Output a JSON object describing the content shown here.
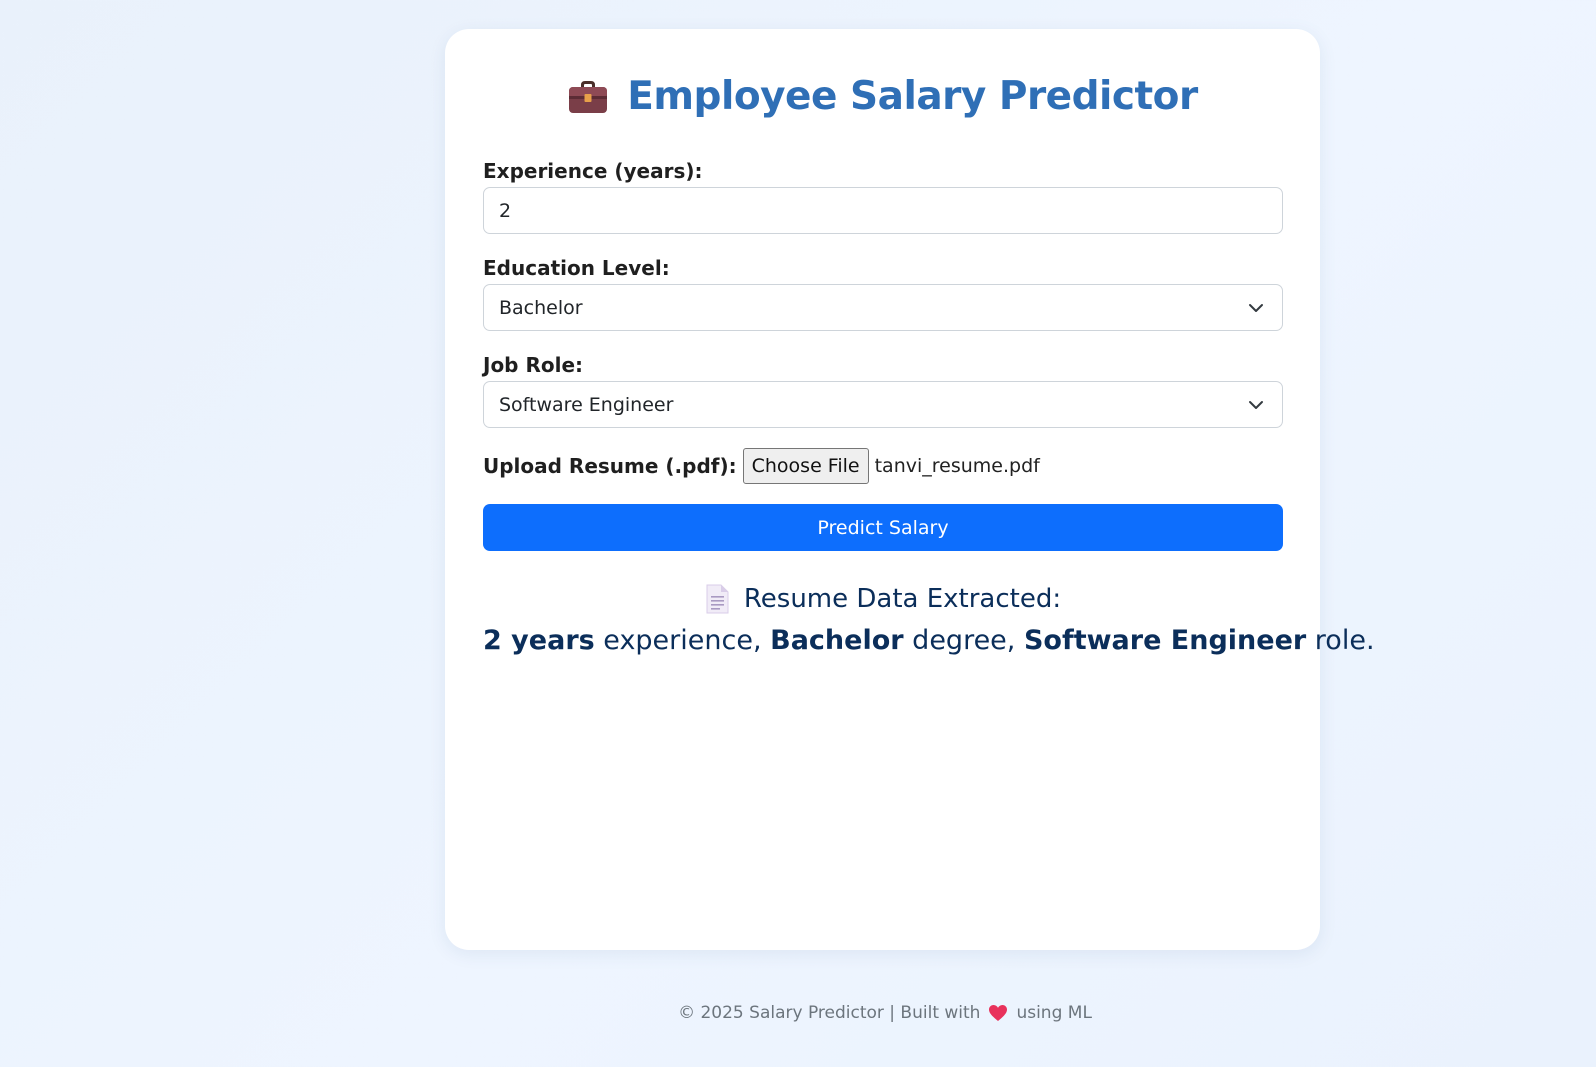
{
  "header": {
    "title": "Employee Salary Predictor",
    "icon": "briefcase-icon"
  },
  "form": {
    "experience": {
      "label": "Experience (years):",
      "value": "2"
    },
    "education": {
      "label": "Education Level:",
      "selected": "Bachelor"
    },
    "job_role": {
      "label": "Job Role:",
      "selected": "Software Engineer"
    },
    "resume": {
      "label": "Upload Resume (.pdf):",
      "button_label": "Choose File",
      "file_name": "tanvi_resume.pdf"
    },
    "submit_label": "Predict Salary"
  },
  "result": {
    "heading": "Resume Data Extracted:",
    "experience_value": "2 years",
    "experience_suffix": " experience, ",
    "education_value": "Bachelor",
    "education_suffix": " degree, ",
    "role_value": "Software Engineer",
    "role_suffix": " role."
  },
  "footer": {
    "text_before": "© 2025 Salary Predictor | Built with",
    "text_after": "using ML"
  },
  "colors": {
    "title": "#2f6fb6",
    "primary_button": "#0d6efd",
    "result_text": "#0b2e5a",
    "footer_text": "#6c757d",
    "heart": "#e8315b"
  }
}
